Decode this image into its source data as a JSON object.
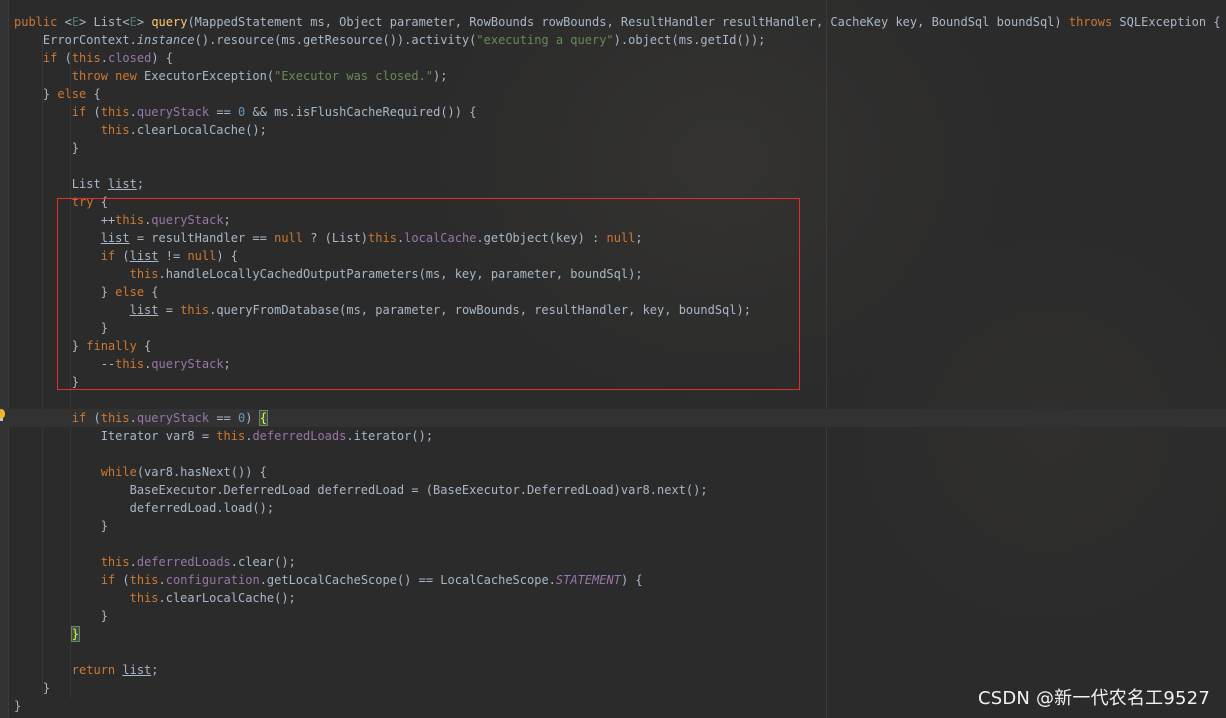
{
  "colors": {
    "background": "#2b2b2b",
    "keyword": "#cc7832",
    "method": "#ffc66d",
    "string": "#6a8759",
    "number": "#6897bb",
    "field": "#9876aa",
    "text": "#a9b7c6",
    "highlight_box": "#e0302a"
  },
  "watermark": "CSDN @新一代农名工9527",
  "icons": {
    "gutter": "lightbulb-icon"
  },
  "code": [
    [
      [
        "kw",
        "public "
      ],
      [
        "t",
        "<"
      ],
      [
        "gen",
        "E"
      ],
      [
        "t",
        "> List<"
      ],
      [
        "gen",
        "E"
      ],
      [
        "t",
        "> "
      ],
      [
        "fn",
        "query"
      ],
      [
        "t",
        "(MappedStatement ms, Object parameter, RowBounds rowBounds, ResultHandler resultHandler, CacheKey key, BoundSql boundSql) "
      ],
      [
        "kw",
        "throws "
      ],
      [
        "t",
        "SQLException {"
      ]
    ],
    [
      [
        "t",
        "    ErrorContext."
      ],
      [
        "ital",
        "instance"
      ],
      [
        "t",
        "().resource(ms.getResource()).activity("
      ],
      [
        "str",
        "\"executing a query\""
      ],
      [
        "t",
        ").object(ms.getId());"
      ]
    ],
    [
      [
        "t",
        "    "
      ],
      [
        "kw",
        "if "
      ],
      [
        "t",
        "("
      ],
      [
        "kw",
        "this"
      ],
      [
        "t",
        "."
      ],
      [
        "fld",
        "closed"
      ],
      [
        "t",
        ") {"
      ]
    ],
    [
      [
        "t",
        "        "
      ],
      [
        "kw",
        "throw new "
      ],
      [
        "t",
        "ExecutorException("
      ],
      [
        "str",
        "\"Executor was closed.\""
      ],
      [
        "t",
        ");"
      ]
    ],
    [
      [
        "t",
        "    } "
      ],
      [
        "kw",
        "else "
      ],
      [
        "t",
        "{"
      ]
    ],
    [
      [
        "t",
        "        "
      ],
      [
        "kw",
        "if "
      ],
      [
        "t",
        "("
      ],
      [
        "kw",
        "this"
      ],
      [
        "t",
        "."
      ],
      [
        "fld",
        "queryStack "
      ],
      [
        "t",
        "== "
      ],
      [
        "num",
        "0 "
      ],
      [
        "t",
        "&& ms.isFlushCacheRequired()) {"
      ]
    ],
    [
      [
        "t",
        "            "
      ],
      [
        "kw",
        "this"
      ],
      [
        "t",
        ".clearLocalCache();"
      ]
    ],
    [
      [
        "t",
        "        }"
      ]
    ],
    [
      [
        "t",
        ""
      ]
    ],
    [
      [
        "t",
        "        List "
      ],
      [
        "ul",
        "list"
      ],
      [
        "t",
        ";"
      ]
    ],
    [
      [
        "t",
        "        "
      ],
      [
        "kw",
        "try "
      ],
      [
        "t",
        "{"
      ]
    ],
    [
      [
        "t",
        "            ++"
      ],
      [
        "kw",
        "this"
      ],
      [
        "t",
        "."
      ],
      [
        "fld",
        "queryStack"
      ],
      [
        "t",
        ";"
      ]
    ],
    [
      [
        "t",
        "            "
      ],
      [
        "ul",
        "list"
      ],
      [
        "t",
        " = resultHandler == "
      ],
      [
        "kw",
        "null "
      ],
      [
        "t",
        "? (List)"
      ],
      [
        "kw",
        "this"
      ],
      [
        "t",
        "."
      ],
      [
        "fld",
        "localCache"
      ],
      [
        "t",
        ".getObject(key) : "
      ],
      [
        "kw",
        "null"
      ],
      [
        "t",
        ";"
      ]
    ],
    [
      [
        "t",
        "            "
      ],
      [
        "kw",
        "if "
      ],
      [
        "t",
        "("
      ],
      [
        "ul",
        "list"
      ],
      [
        "t",
        " != "
      ],
      [
        "kw",
        "null"
      ],
      [
        "t",
        ") {"
      ]
    ],
    [
      [
        "t",
        "                "
      ],
      [
        "kw",
        "this"
      ],
      [
        "t",
        ".handleLocallyCachedOutputParameters(ms, key, parameter, boundSql);"
      ]
    ],
    [
      [
        "t",
        "            } "
      ],
      [
        "kw",
        "else "
      ],
      [
        "t",
        "{"
      ]
    ],
    [
      [
        "t",
        "                "
      ],
      [
        "ul",
        "list"
      ],
      [
        "t",
        " = "
      ],
      [
        "kw",
        "this"
      ],
      [
        "t",
        ".queryFromDatabase(ms, parameter, rowBounds, resultHandler, key, boundSql);"
      ]
    ],
    [
      [
        "t",
        "            }"
      ]
    ],
    [
      [
        "t",
        "        } "
      ],
      [
        "kw",
        "finally "
      ],
      [
        "t",
        "{"
      ]
    ],
    [
      [
        "t",
        "            --"
      ],
      [
        "kw",
        "this"
      ],
      [
        "t",
        "."
      ],
      [
        "fld",
        "queryStack"
      ],
      [
        "t",
        ";"
      ]
    ],
    [
      [
        "t",
        "        }"
      ]
    ],
    [
      [
        "t",
        ""
      ]
    ],
    [
      [
        "t",
        "        "
      ],
      [
        "kw",
        "if "
      ],
      [
        "t",
        "("
      ],
      [
        "kw",
        "this"
      ],
      [
        "t",
        "."
      ],
      [
        "fld",
        "queryStack "
      ],
      [
        "t",
        "== "
      ],
      [
        "num",
        "0"
      ],
      [
        "t",
        ") "
      ],
      [
        "brace",
        "{"
      ]
    ],
    [
      [
        "t",
        "            Iterator var8 = "
      ],
      [
        "kw",
        "this"
      ],
      [
        "t",
        "."
      ],
      [
        "fld",
        "deferredLoads"
      ],
      [
        "t",
        ".iterator();"
      ]
    ],
    [
      [
        "t",
        ""
      ]
    ],
    [
      [
        "t",
        "            "
      ],
      [
        "kw",
        "while"
      ],
      [
        "t",
        "(var8.hasNext()) {"
      ]
    ],
    [
      [
        "t",
        "                BaseExecutor.DeferredLoad deferredLoad = (BaseExecutor.DeferredLoad)var8.next();"
      ]
    ],
    [
      [
        "t",
        "                deferredLoad.load();"
      ]
    ],
    [
      [
        "t",
        "            }"
      ]
    ],
    [
      [
        "t",
        ""
      ]
    ],
    [
      [
        "t",
        "            "
      ],
      [
        "kw",
        "this"
      ],
      [
        "t",
        "."
      ],
      [
        "fld",
        "deferredLoads"
      ],
      [
        "t",
        ".clear();"
      ]
    ],
    [
      [
        "t",
        "            "
      ],
      [
        "kw",
        "if "
      ],
      [
        "t",
        "("
      ],
      [
        "kw",
        "this"
      ],
      [
        "t",
        "."
      ],
      [
        "fld",
        "configuration"
      ],
      [
        "t",
        ".getLocalCacheScope() == LocalCacheScope."
      ],
      [
        "ifld",
        "STATEMENT"
      ],
      [
        "t",
        ") {"
      ]
    ],
    [
      [
        "t",
        "                "
      ],
      [
        "kw",
        "this"
      ],
      [
        "t",
        ".clearLocalCache();"
      ]
    ],
    [
      [
        "t",
        "            }"
      ]
    ],
    [
      [
        "t",
        "        "
      ],
      [
        "brace",
        "}"
      ]
    ],
    [
      [
        "t",
        ""
      ]
    ],
    [
      [
        "t",
        "        "
      ],
      [
        "kw",
        "return "
      ],
      [
        "ul",
        "list"
      ],
      [
        "t",
        ";"
      ]
    ],
    [
      [
        "t",
        "    }"
      ]
    ],
    [
      [
        "t",
        "}"
      ]
    ]
  ]
}
